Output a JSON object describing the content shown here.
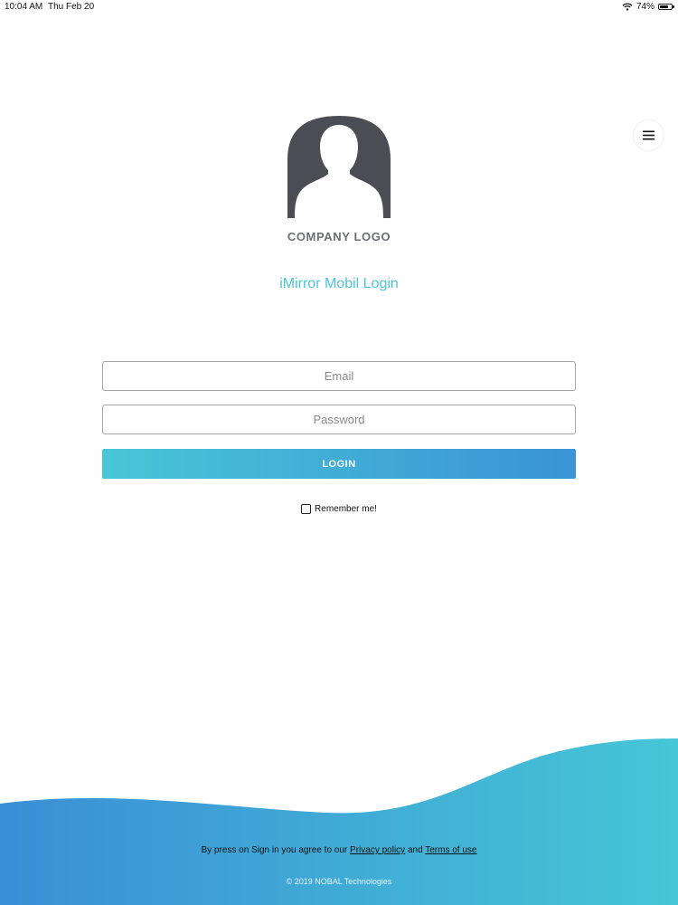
{
  "status_bar": {
    "time": "10:04 AM",
    "date": "Thu Feb 20",
    "battery": "74%",
    "battery_level": 0.74,
    "wifi_icon": "wifi-icon",
    "battery_icon": "battery-icon"
  },
  "menu": {
    "icon": "hamburger-menu-icon"
  },
  "brand": {
    "logo_icon": "user-silhouette-icon",
    "logo_label": "COMPANY LOGO",
    "app_title": "iMirror Mobil Login"
  },
  "form": {
    "email_placeholder": "Email",
    "email_value": "",
    "password_placeholder": "Password",
    "password_value": "",
    "login_label": "LOGIN",
    "remember_label": "Remember me!",
    "remember_checked": false
  },
  "footer": {
    "agree_prefix": "By press on Sign in you agree to our",
    "privacy_link": "Privacy policy",
    "and_text": "and",
    "terms_link": "Terms of use",
    "copyright": "© 2019 NOBAL Technologies"
  },
  "colors": {
    "accent": "#4cc4d9",
    "gradient_start": "#48c6d6",
    "gradient_end": "#3a93d6",
    "logo_gray": "#4a4d54"
  }
}
